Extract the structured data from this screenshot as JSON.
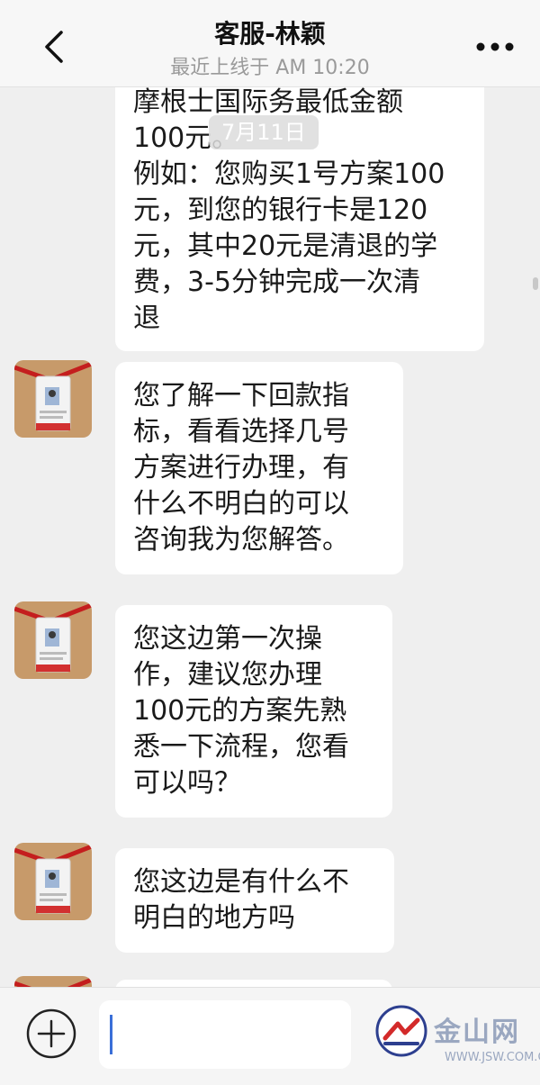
{
  "header": {
    "title": "客服-林颖",
    "subtitle": "最近上线于 AM 10:20"
  },
  "date_pill": "7月11日",
  "messages": [
    {
      "lines": [
        "摩根士国际务最低金额",
        "100元。",
        "例如：您购买1号方案100",
        "元，到您的银行卡是120",
        "元，其中20元是清退的学",
        "费，3-5分钟完成一次清",
        "退"
      ]
    },
    {
      "lines": [
        "您了解一下回款指",
        "标，看看选择几号",
        "方案进行办理，有",
        "什么不明白的可以",
        "咨询我为您解答。"
      ]
    },
    {
      "lines": [
        "您这边第一次操",
        "作，建议您办理",
        "100元的方案先熟",
        "悉一下流程，您看",
        "可以吗？"
      ]
    },
    {
      "lines": [
        "您这边是有什么不",
        "明白的地方吗"
      ]
    }
  ],
  "watermark": {
    "name": "金山网",
    "url": "WWW.JSW.COM.CN"
  },
  "colors": {
    "background": "#efefef",
    "bubble": "#ffffff",
    "caret": "#3a6fd8"
  }
}
